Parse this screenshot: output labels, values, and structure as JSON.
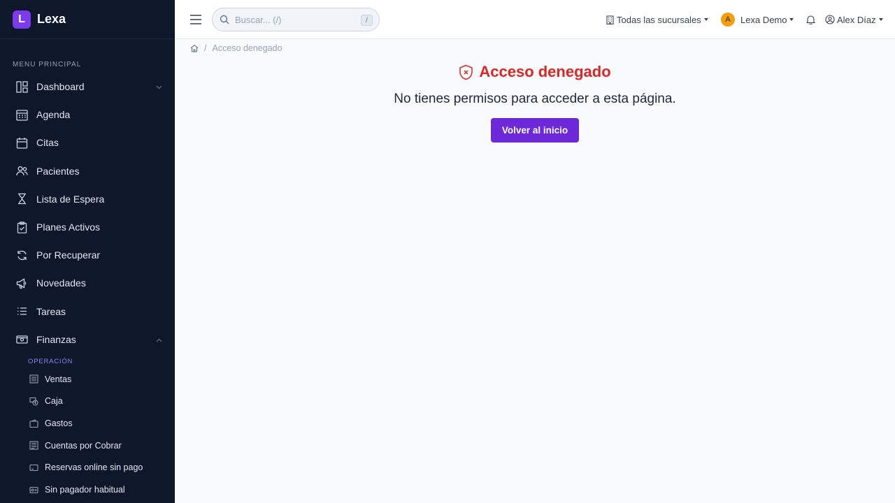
{
  "brand": {
    "logo_letter": "L",
    "name": "Lexa",
    "accent": "#7c3aed"
  },
  "sidebar": {
    "section_label": "MENU PRINCIPAL",
    "items": [
      {
        "label": "Dashboard",
        "icon": "dashboard-icon",
        "chevron": "down"
      },
      {
        "label": "Agenda",
        "icon": "calendar-grid-icon"
      },
      {
        "label": "Citas",
        "icon": "calendar-icon"
      },
      {
        "label": "Pacientes",
        "icon": "users-icon"
      },
      {
        "label": "Lista de Espera",
        "icon": "hourglass-icon"
      },
      {
        "label": "Planes Activos",
        "icon": "clipboard-check-icon"
      },
      {
        "label": "Por Recuperar",
        "icon": "refresh-icon"
      },
      {
        "label": "Novedades",
        "icon": "megaphone-icon"
      },
      {
        "label": "Tareas",
        "icon": "list-icon"
      },
      {
        "label": "Finanzas",
        "icon": "cash-icon",
        "chevron": "up"
      }
    ],
    "finanzas_sub_label": "OPERACIÓN",
    "finanzas_items": [
      {
        "label": "Ventas",
        "icon": "receipt-icon"
      },
      {
        "label": "Caja",
        "icon": "cash-register-icon"
      },
      {
        "label": "Gastos",
        "icon": "wallet-icon"
      },
      {
        "label": "Cuentas por Cobrar",
        "icon": "ledger-icon"
      },
      {
        "label": "Reservas online sin pago",
        "icon": "card-icon"
      },
      {
        "label": "Sin pagador habitual",
        "icon": "id-card-icon"
      }
    ]
  },
  "topbar": {
    "search_placeholder": "Buscar... (/)",
    "search_shortcut": "/",
    "branch_selector": "Todas las sucursales",
    "org_avatar": "A",
    "org_name": "Lexa Demo",
    "user_name": "Alex Díaz"
  },
  "breadcrumb": {
    "current": "Acceso denegado"
  },
  "main": {
    "title": "Acceso denegado",
    "message": "No tienes permisos para acceder a esta página.",
    "button_label": "Volver al inicio"
  },
  "colors": {
    "sidebar_bg": "#0f172a",
    "danger": "#dc2626",
    "primary_button": "#6d28d9"
  }
}
